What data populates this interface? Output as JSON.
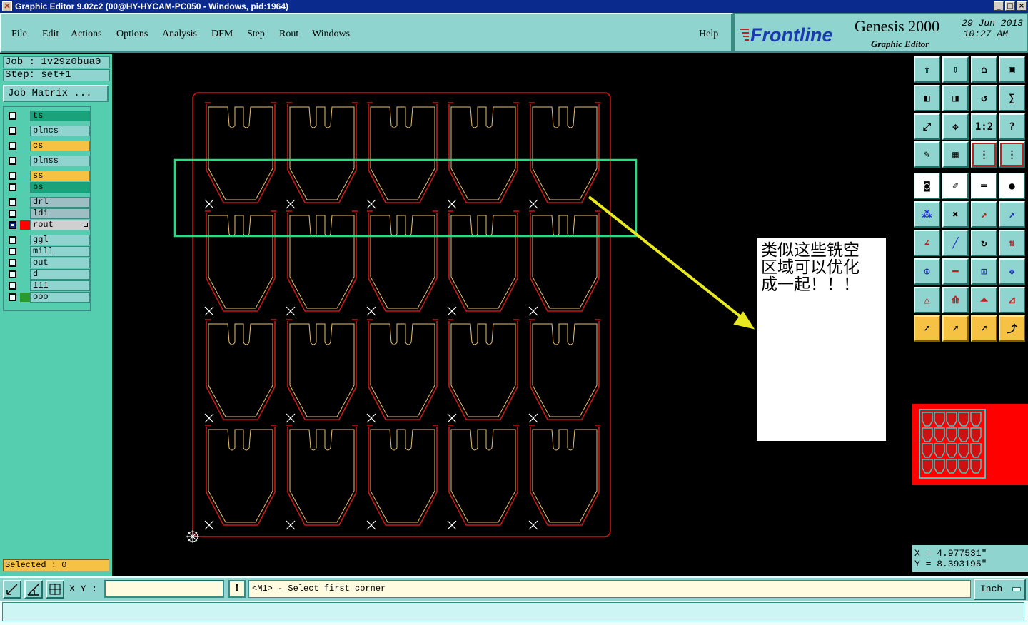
{
  "window": {
    "title": "Graphic Editor 9.02c2 (00@HY-HYCAM-PC050 - Windows, pid:1964)",
    "buttons": [
      "_",
      "□",
      "×"
    ]
  },
  "menu": {
    "items": [
      "File",
      "Edit",
      "Actions",
      "Options",
      "Analysis",
      "DFM",
      "Step",
      "Rout",
      "Windows"
    ],
    "help": "Help"
  },
  "brand": {
    "logo_text": "Frontline",
    "product": "Genesis 2000",
    "subtitle": "Graphic Editor",
    "date": "29 Jun 2013",
    "time": "10:27 AM"
  },
  "job": {
    "job_line": "Job : 1v29z0bua0",
    "step_line": "Step: set+1",
    "matrix_button": "Job Matrix ..."
  },
  "layers": [
    {
      "name": "ts",
      "color": "#1aa37a",
      "selected": false
    },
    {
      "name": "plncs",
      "color": "#90d4d0",
      "selected": false
    },
    {
      "name": "cs",
      "color": "#f6c244",
      "selected": false
    },
    {
      "name": "plnss",
      "color": "#90d4d0",
      "selected": false
    },
    {
      "name": "ss",
      "color": "#f6c244",
      "selected": false
    },
    {
      "name": "bs",
      "color": "#1aa37a",
      "selected": false
    },
    {
      "name": "drl",
      "color": "#9dbfc4",
      "selected": false
    },
    {
      "name": "ldi",
      "color": "#9dbfc4",
      "selected": false
    },
    {
      "name": "rout",
      "color": "#d0d0d0",
      "selected": true,
      "swatch": "#ff0000"
    },
    {
      "name": "ggl",
      "color": "#90d4d0",
      "selected": false
    },
    {
      "name": "mill",
      "color": "#90d4d0",
      "selected": false
    },
    {
      "name": "out",
      "color": "#90d4d0",
      "selected": false
    },
    {
      "name": "d",
      "color": "#90d4d0",
      "selected": false
    },
    {
      "name": "111",
      "color": "#90d4d0",
      "selected": false
    },
    {
      "name": "ooo",
      "color": "#90d4d0",
      "selected": false,
      "swatch": "#2a9a2a"
    }
  ],
  "selected_text": "Selected : 0",
  "annotation": {
    "note_text": "类似这些铣空\n区域可以优化\n成一起！！！"
  },
  "toolbar": {
    "icons": [
      "step-up-icon",
      "step-down-icon",
      "home-icon",
      "window-icon",
      "pan-left-icon",
      "pan-right-icon",
      "undo-zoom-icon",
      "mirror-icon",
      "fit-view-icon",
      "zoom-center-icon",
      "one-to-one-icon",
      "help-icon",
      "settings-icon",
      "grid-icon",
      "layers-red-icon",
      "layers-alt-icon",
      "snapshot-icon",
      "pencil-icon",
      "ruler-icon",
      "pad-icon",
      "connect-icon",
      "cross-icon",
      "line-add-icon",
      "line-arrow-icon",
      "angle-icon",
      "slope-icon",
      "arc-icon",
      "split-icon",
      "move-icon",
      "minus-icon",
      "measure-icon",
      "group-icon",
      "triangle-icon",
      "triangle-arrow-icon",
      "triangle-box-icon",
      "triangle-cross-icon",
      "select-icon",
      "select-box-icon",
      "select-frame-icon",
      "select-net-icon"
    ],
    "labels": {
      "one_to_one": "1:2"
    }
  },
  "coords": {
    "x_line": "X = 4.977531\"",
    "y_line": "Y = 8.393195\""
  },
  "command": {
    "xy_label": "X Y :",
    "xy_value": "",
    "excl": "!",
    "prompt": "<M1> - Select first corner",
    "unit": "Inch"
  }
}
